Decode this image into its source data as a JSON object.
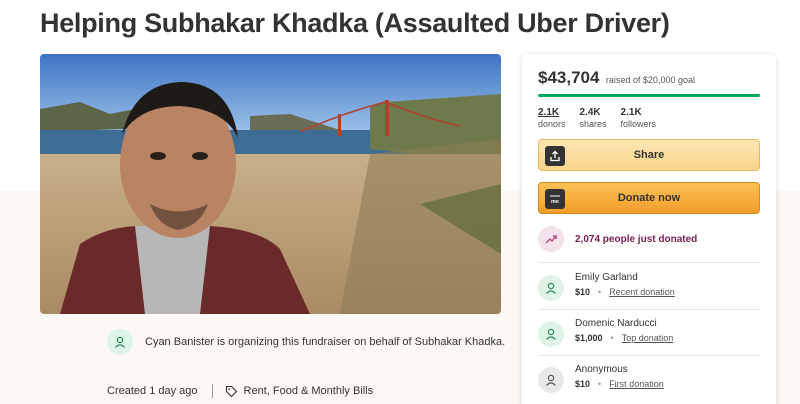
{
  "page": {
    "title": "Helping Subhakar Khadka (Assaulted Uber Driver)"
  },
  "organizer": {
    "text": "Cyan Banister is organizing this fundraiser on behalf of Subhakar Khadka."
  },
  "meta": {
    "created": "Created 1 day ago",
    "category": "Rent, Food & Monthly Bills"
  },
  "campaign": {
    "amount_raised": "$43,704",
    "goal_text": "raised of $20,000 goal",
    "progress_fraction": 1.0,
    "stats": [
      {
        "value": "2.1K",
        "label": "donors"
      },
      {
        "value": "2.4K",
        "label": "shares"
      },
      {
        "value": "2.1K",
        "label": "followers"
      }
    ],
    "share_label": "Share",
    "donate_label": "Donate now",
    "donate_icon_text": "me",
    "trend_text": "2,074 people just donated"
  },
  "donations": [
    {
      "name": "Emily Garland",
      "amount": "$10",
      "tag": "Recent donation",
      "avatar": "person-icon"
    },
    {
      "name": "Domenic Narducci",
      "amount": "$1,000",
      "tag": "Top donation",
      "avatar": "person-icon"
    },
    {
      "name": "Anonymous",
      "amount": "$10",
      "tag": "First donation",
      "avatar": "person-icon"
    }
  ],
  "colors": {
    "brand_green": "#02a95c",
    "share_button": "#f9d48b",
    "donate_button": "#f6a93a",
    "trend_text": "#7a1e4e"
  }
}
